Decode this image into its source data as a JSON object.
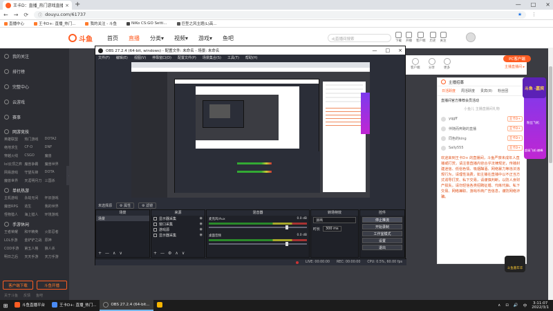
{
  "browser": {
    "tab_title": "王卡D：直播_热门游戏直播_斗",
    "tab_close": "×",
    "new_tab": "+",
    "window_controls": [
      "—",
      "□",
      "×"
    ],
    "nav": [
      "←",
      "→",
      "⟳"
    ],
    "lock": "ⓘ",
    "url": "douyu.com/61737",
    "star": "★",
    "bookmarks": [
      "直播中心",
      "王卡D+: 直播_热门...",
      "我的关注 - 斗鱼",
      "NiKo CS:GO Setti...",
      "巨型之风主题(L)高..."
    ]
  },
  "site": {
    "logo": "斗鱼",
    "nav": [
      {
        "label": "首页",
        "active": false
      },
      {
        "label": "直播",
        "active": true
      },
      {
        "label": "分类▾",
        "active": false
      },
      {
        "label": "视频▾",
        "active": false
      },
      {
        "label": "游戏▾",
        "active": false
      },
      {
        "label": "鱼吧",
        "active": false
      }
    ],
    "search_placeholder": "dj直播间搜索",
    "header_icons": [
      "下载",
      "开播",
      "客户端",
      "历史",
      "关注"
    ],
    "sidebar": {
      "items": [
        "我的关注",
        "排行榜",
        "完整中心",
        "云游戏",
        "赛事"
      ],
      "section_online": "网游竞技",
      "online_games": [
        "英雄联盟",
        "热门游戏",
        "DOTA2",
        "绝地求生",
        "CF·O",
        "DNF",
        "穿越火线",
        "CSGO",
        "魔兽",
        "lol云顶之弈",
        "魔兽争霸",
        "魔兽世界",
        "网易游戏",
        "守望先锋",
        "DOTA",
        "魔兽世界",
        "天涯明月刀",
        "三国杀"
      ],
      "section_single": "单机热游",
      "single_games": [
        "主机游戏",
        "永劫无间",
        "怀旧游戏",
        "魔兽RPG",
        "逃生",
        "我的世界",
        "怪物猎人",
        "海上猎人",
        "环境游戏"
      ],
      "section_mobile": "手游休闲",
      "mobile_games": [
        "王者荣耀",
        "和平精英",
        "火影忍者",
        "LOL手游",
        "金铲铲之战",
        "原神",
        "COD手游",
        "第五人格",
        "狼人杀",
        "明日之后",
        "天天手游",
        "天刀手游"
      ],
      "buttons": [
        "客户端下载",
        "斗鱼开播"
      ],
      "footer": [
        "关于斗鱼",
        "反馈",
        "鱼吧"
      ],
      "collapse": "‹"
    },
    "right_top_icons": [
      "客户端",
      "分享",
      "更多"
    ],
    "pc_button": "PC客户端",
    "sub_link": "主播直播间 ▸",
    "panel": {
      "head": "主播招募",
      "tabs": [
        "日活跃度",
        "周活跃度",
        "贵宾(8)",
        "粉丝团"
      ],
      "rank_title": "直播间官方推荐会员活动",
      "rank_sub": "小鱼儿 主播直播间礼物",
      "rows": [
        {
          "name": "yqgff",
          "badge": "王卡D+"
        },
        {
          "name": "伴随而奔跑的直播",
          "badge": "王卡D+"
        },
        {
          "name": "同色的king",
          "badge": "王卡D+"
        },
        {
          "name": "Sally555",
          "badge": "王卡D+"
        }
      ],
      "notice": "欢迎来到王卡D+ 的直播间，斗鱼严禁未成年人直播或打赏，请注意直播内容合乎法律规定，传播封建迷信、低俗色情、吸烟酗酒、网络暴力等违法违规行为，请理性消费，如主播在直播中以不正当方式诱导打赏、私下交易，请谨慎判断，以防人身财产损失。请勿轻信各类招聘征婚、代练代抽、私下交易、网络兼职、游戏币商广告信息，谨防网络诈骗。"
    },
    "vertical_ad": {
      "top": "斗鱼 ·嘉宾",
      "label": "粉丝飞机",
      "label2": "超级飞机·巅峰"
    },
    "right_badge": "斗鱼嘉年华"
  },
  "obs": {
    "title": "OBS 27.2.4 (64-bit, windows) - 配置文件: 未命名 - 场景: 未命名",
    "window_controls": [
      "—",
      "□",
      "×"
    ],
    "menu": [
      "文件(F)",
      "编辑(E)",
      "视图(V)",
      "停靠窗口(D)",
      "配置文件(P)",
      "场景集合(S)",
      "工具(T)",
      "帮助(H)"
    ],
    "scene_bar": [
      "未选择源",
      "⚙ 属性",
      "⚙ 滤镜"
    ],
    "scenes_head": "场景",
    "scenes": [
      "场景"
    ],
    "sources_head": "来源",
    "sources": [
      "显示器采集",
      "窗口采集",
      "游戏源",
      "显示器采集"
    ],
    "mixer_head": "混音器",
    "mixer": [
      {
        "name": "麦克风/Aux",
        "db": "0.0 dB"
      },
      {
        "name": "桌面音频",
        "db": "0.0 dB"
      }
    ],
    "transition_head": "转场特效",
    "transition_type": "淡出",
    "transition_label": "时长",
    "transition_duration": "300 ms",
    "controls_head": "控件",
    "controls": [
      {
        "label": "停止推流",
        "active": true
      },
      {
        "label": "开始录制",
        "active": false
      },
      {
        "label": "工作室模式",
        "active": false
      },
      {
        "label": "设置",
        "active": false
      },
      {
        "label": "退出",
        "active": false
      }
    ],
    "status": [
      "LIVE: 00:00:00",
      "REC: 00:00:00",
      "CPU: 0.5%, 60.00 fps"
    ],
    "dock_tools": [
      "+",
      "—",
      "∧",
      "∨"
    ],
    "source_tools": [
      "+",
      "—",
      "⚙",
      "∧",
      "∨"
    ]
  },
  "taskbar": {
    "start": "⊞",
    "tasks": [
      {
        "label": "斗鱼直播平台",
        "color": "#ff5d23",
        "active": false
      },
      {
        "label": "王卡D+: 直播_热门...",
        "color": "#4a8cf7",
        "active": false
      },
      {
        "label": "OBS 27.2.4 (64-bit...",
        "color": "#333333",
        "active": true
      },
      {
        "label": "",
        "color": "#f7b500",
        "active": false
      }
    ],
    "tray": [
      "∧",
      "⊡",
      "🔊",
      "中"
    ],
    "time": "3:11:07",
    "date": "2022/3/1"
  },
  "colors": {
    "brand": "#ff5d23",
    "obs_bg": "#2b2e38",
    "sidebar_bg": "#2c2d33"
  }
}
